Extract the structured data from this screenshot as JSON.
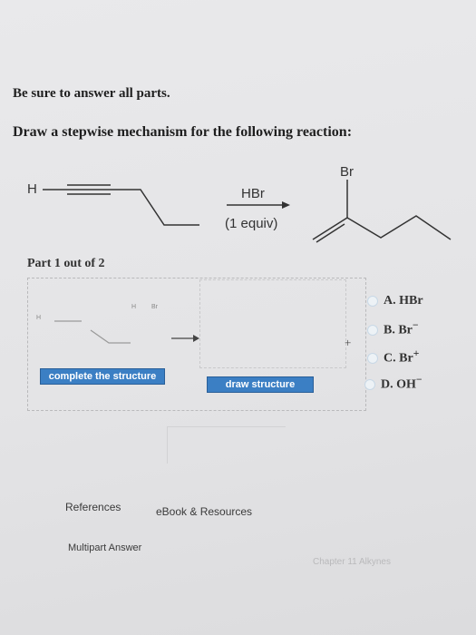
{
  "instructions": {
    "line1": "Be sure to answer all parts.",
    "line2": "Draw a stepwise mechanism for the following reaction:"
  },
  "reaction": {
    "reactant_h": "H",
    "reagent": "HBr",
    "equiv": "(1 equiv)",
    "product_br": "Br"
  },
  "part": {
    "label": "Part 1 out of 2"
  },
  "workspace": {
    "left_h": "H",
    "left_br": "Br",
    "small_h": "H",
    "plus": "+",
    "complete_button": "complete the structure",
    "draw_button": "draw structure"
  },
  "options": [
    {
      "letter": "A.",
      "text": "HBr"
    },
    {
      "letter": "B.",
      "text": "Br",
      "sup": "−"
    },
    {
      "letter": "C.",
      "text": "Br",
      "sup": "+"
    },
    {
      "letter": "D.",
      "text": "OH",
      "sup": "−"
    }
  ],
  "footer": {
    "references": "References",
    "ebook": "eBook & Resources",
    "multipart": "Multipart Answer",
    "chapter": "Chapter 11 Alkynes"
  }
}
